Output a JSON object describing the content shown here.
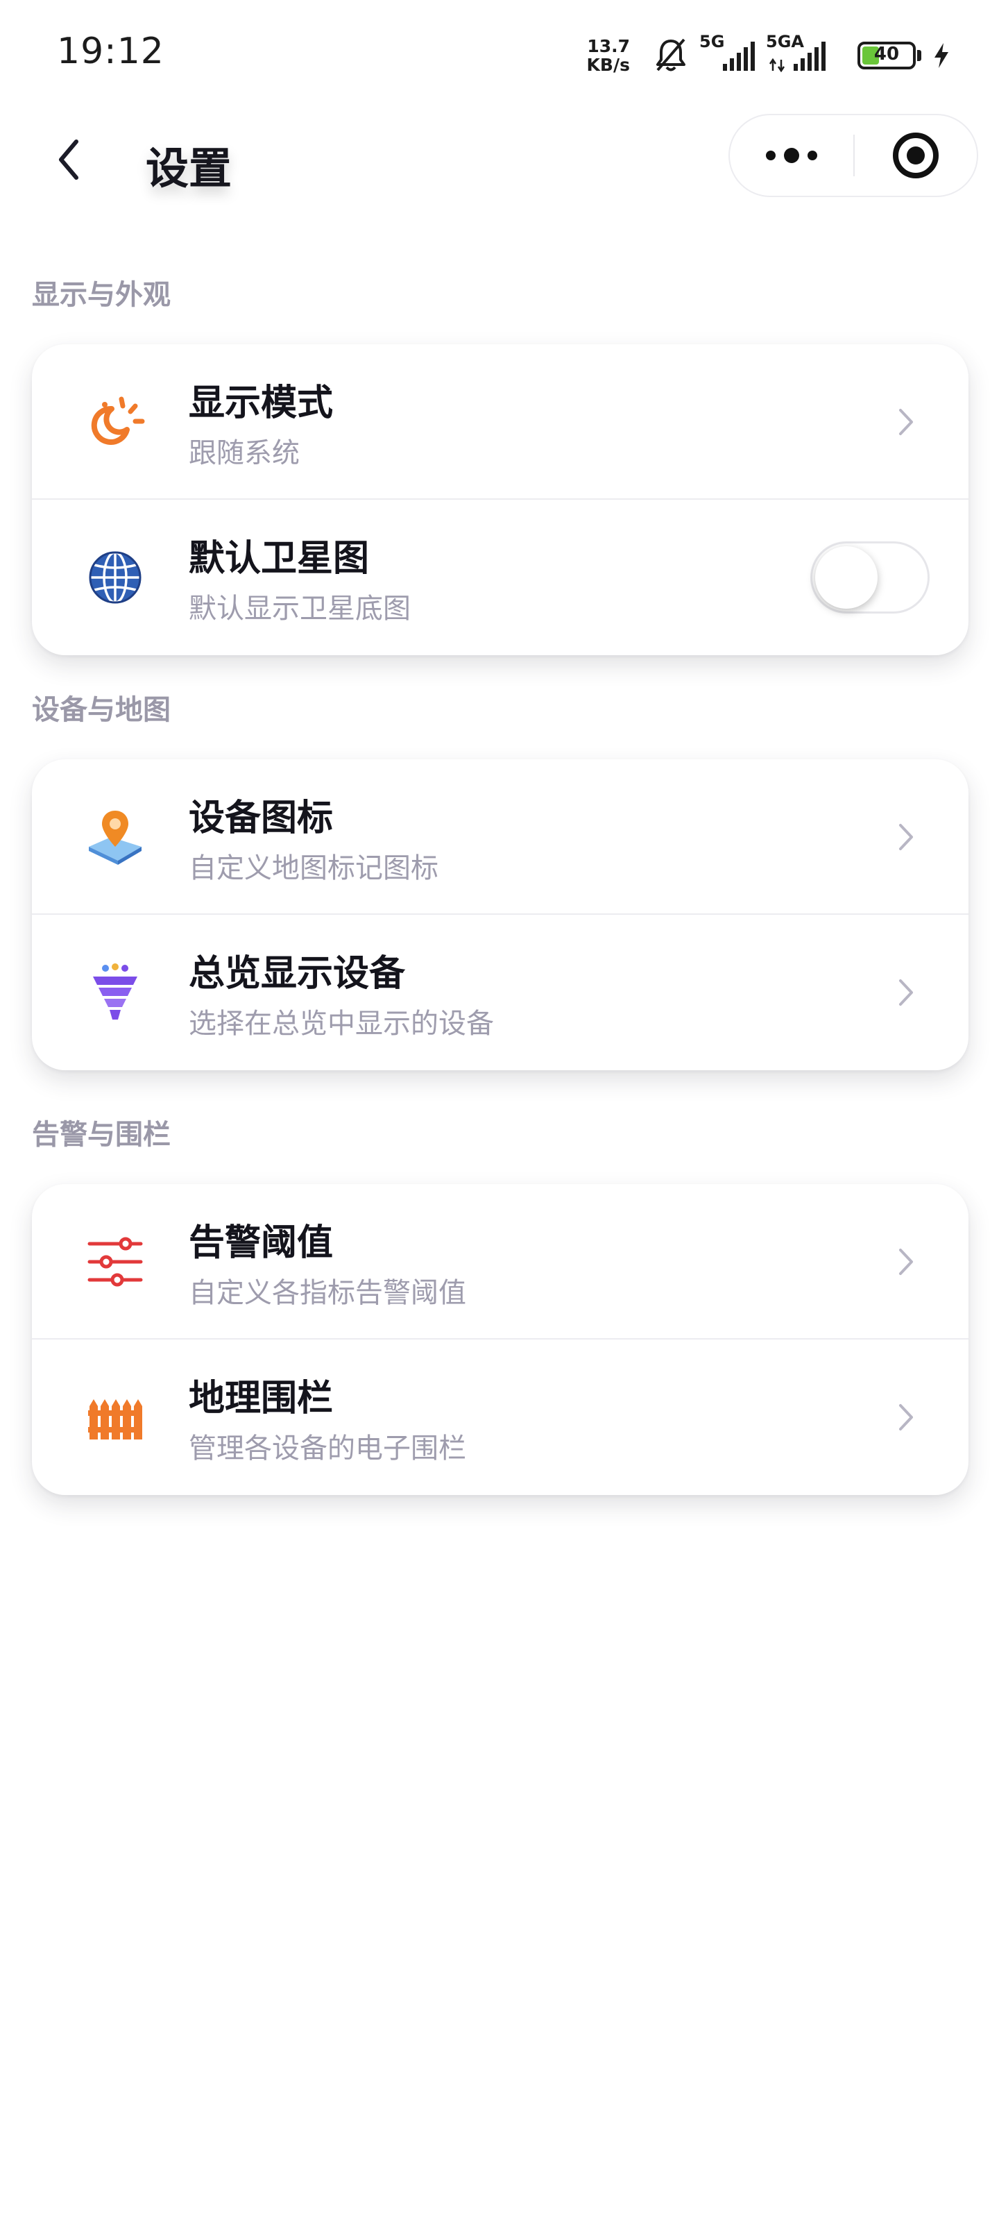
{
  "status_bar": {
    "time": "19:12",
    "net_speed_value": "13.7",
    "net_speed_unit": "KB/s",
    "sim1_label": "5G",
    "sim2_label": "5GA",
    "battery_level": "40",
    "battery_fill_percent": 40
  },
  "nav": {
    "title": "设置"
  },
  "sections": [
    {
      "title": "显示与外观",
      "rows": [
        {
          "title": "显示模式",
          "subtitle": "跟随系统",
          "icon": "sun-moon-icon",
          "control": "chevron"
        },
        {
          "title": "默认卫星图",
          "subtitle": "默认显示卫星底图",
          "icon": "globe-icon",
          "control": "toggle",
          "toggle_on": false
        }
      ]
    },
    {
      "title": "设备与地图",
      "rows": [
        {
          "title": "设备图标",
          "subtitle": "自定义地图标记图标",
          "icon": "map-pin-icon",
          "control": "chevron"
        },
        {
          "title": "总览显示设备",
          "subtitle": "选择在总览中显示的设备",
          "icon": "funnel-icon",
          "control": "chevron"
        }
      ]
    },
    {
      "title": "告警与围栏",
      "rows": [
        {
          "title": "告警阈值",
          "subtitle": "自定义各指标告警阈值",
          "icon": "sliders-icon",
          "control": "chevron"
        },
        {
          "title": "地理围栏",
          "subtitle": "管理各设备的电子围栏",
          "icon": "fence-icon",
          "control": "chevron"
        }
      ]
    }
  ],
  "colors": {
    "accent_orange": "#f07a2a",
    "globe_blue": "#2f5fb5",
    "funnel_purple": "#7b4de8",
    "alert_red": "#e2393a",
    "section_title": "#9a98a8",
    "subtitle": "#9e9cad"
  }
}
